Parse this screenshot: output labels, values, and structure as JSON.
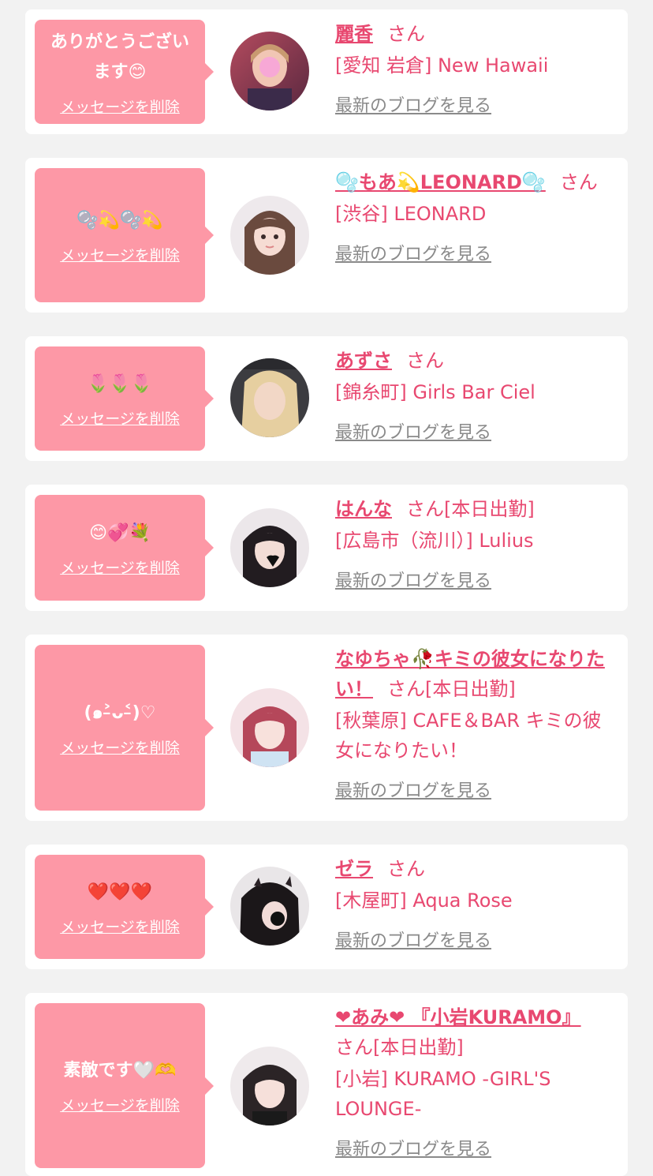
{
  "common": {
    "delete_label": "メッセージを削除",
    "blog_label": "最新のブログを見る",
    "honorific": "さん",
    "accent_color": "#e84870",
    "bubble_color": "#fd98a6"
  },
  "cards": [
    {
      "message": "ありがとうございます😊",
      "name": "麗香",
      "honorific": "さん",
      "status": "",
      "shop": "[愛知 岩倉] New Hawaii"
    },
    {
      "message": "🫧💫🫧💫",
      "name": "🫧もあ💫LEONARD🫧",
      "honorific": "さん",
      "status": "",
      "shop": "[渋谷] LEONARD"
    },
    {
      "message": "🌷🌷🌷",
      "name": "あずさ",
      "honorific": "さん",
      "status": "",
      "shop": "[錦糸町] Girls Bar Ciel"
    },
    {
      "message": "😊💞💐",
      "name": "はんな",
      "honorific": "さん",
      "status": "[本日出勤]",
      "shop": "[広島市（流川）] Lulius"
    },
    {
      "message": "(๑˃̵ᴗ˂̵)♡",
      "name": "なゆちゃ🥀キミの彼女になりたい！",
      "honorific": "さん",
      "status": "[本日出勤]",
      "shop": "[秋葉原] CAFE＆BAR キミの彼女になりたい！"
    },
    {
      "message": "❤️❤️❤️",
      "name": "ゼラ",
      "honorific": "さん",
      "status": "",
      "shop": "[木屋町] Aqua Rose"
    },
    {
      "message": "素敵です🤍🫶",
      "name": "❤あみ❤ 『小岩KURAMO』",
      "honorific": "さん",
      "status": "[本日出勤]",
      "shop": "[小岩] KURAMO -GIRL'S LOUNGE-"
    }
  ]
}
